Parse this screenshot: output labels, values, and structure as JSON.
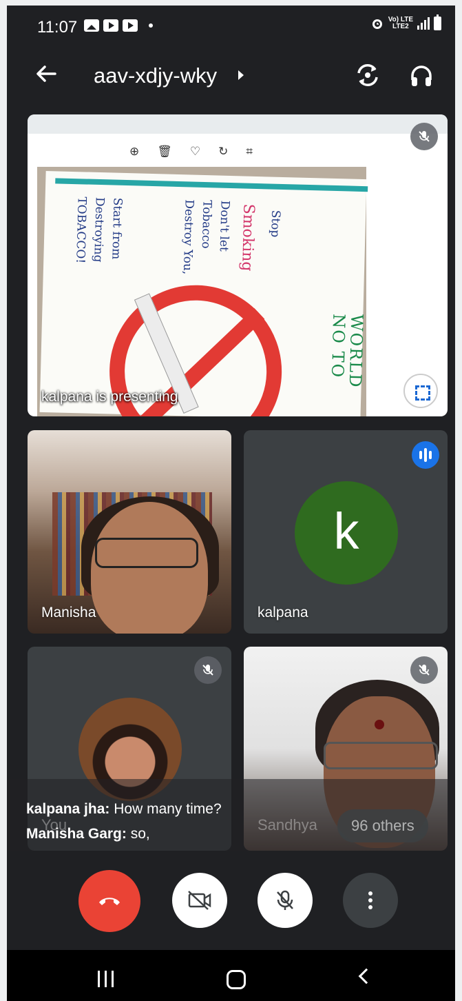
{
  "status": {
    "time": "11:07",
    "network_top": "Vo) LTE",
    "network_bottom": "LTE2"
  },
  "header": {
    "meeting_code": "aav-xdjy-wky"
  },
  "presentation": {
    "label": "kalpana is presenting",
    "poster": {
      "line1": "Stop",
      "line2": "Smoking",
      "line3": "Don't let Tobacco Destroy You,",
      "line4": "Start from Destroying TOBACCO!",
      "side_text": "WORLD NO TO"
    }
  },
  "participants": [
    {
      "name": "Manisha"
    },
    {
      "name": "kalpana",
      "initial": "k"
    },
    {
      "name": "You"
    },
    {
      "name": "Sandhya"
    }
  ],
  "others_pill": "96 others",
  "captions": [
    {
      "speaker": "kalpana jha:",
      "text": "How many time?"
    },
    {
      "speaker": "Manisha Garg:",
      "text": "so,"
    }
  ],
  "colors": {
    "end_call": "#ea4335",
    "speaking_badge": "#1a73e8",
    "avatar_bg": "#2f6b1f"
  }
}
